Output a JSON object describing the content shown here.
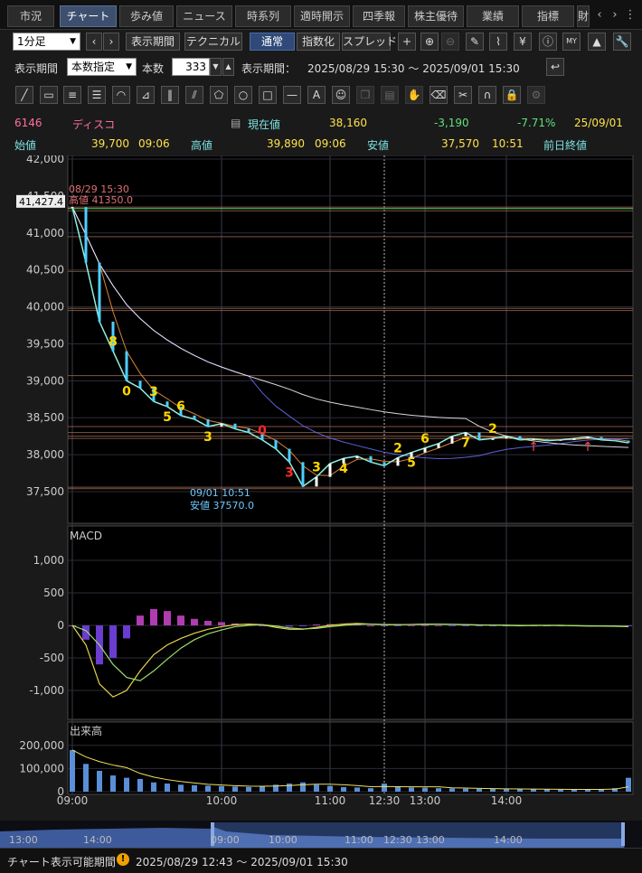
{
  "tabs": [
    "市況",
    "チャート",
    "歩み値",
    "ニュース",
    "時系列",
    "適時開示",
    "四季報",
    "株主優待",
    "業績",
    "指標",
    "財"
  ],
  "active_tab": 1,
  "toolbar": {
    "interval": "1分足",
    "display_period_btn": "表示期間",
    "technical_btn": "テクニカル",
    "normal_btn": "通常",
    "index_btn": "指数化",
    "spread_btn": "スプレッド",
    "my_label": "MY"
  },
  "period_row": {
    "label": "表示期間",
    "mode": "本数指定",
    "count_label": "本数",
    "count": "333",
    "range_label": "表示期間：",
    "range": "2025/08/29 15:30 〜 2025/09/01 15:30"
  },
  "quote": {
    "code": "6146",
    "name": "ディスコ",
    "current_label": "現在値",
    "current": "38,160",
    "change": "-3,190",
    "change_pct": "-7.71%",
    "date": "25/09/01",
    "open_label": "始値",
    "open": "39,700",
    "open_time": "09:06",
    "high_label": "高値",
    "high": "39,890",
    "high_time": "09:06",
    "low_label": "安値",
    "low": "37,570",
    "low_time": "10:51",
    "prev_close_label": "前日終値"
  },
  "colors": {
    "up": "#ff4a4a",
    "down": "#4ecfff",
    "accent": "#ffd700",
    "macd": "#e8d44d",
    "signal": "#9ade6a",
    "hist_pos": "#b03cb0",
    "hist_neg": "#6a3cd0"
  },
  "chart_data": [
    {
      "type": "line",
      "panel": "price",
      "ylim": [
        37500,
        42000
      ],
      "yticks": [
        "42,000",
        "41,500",
        "41,000",
        "40,500",
        "40,000",
        "39,500",
        "39,000",
        "38,500",
        "38,000",
        "37,500"
      ],
      "x": [
        "09:00",
        "09:02",
        "09:04",
        "09:06",
        "09:08",
        "09:10",
        "09:15",
        "09:20",
        "09:30",
        "09:40",
        "09:50",
        "10:00",
        "10:10",
        "10:20",
        "10:30",
        "10:40",
        "10:45",
        "10:51",
        "10:55",
        "11:00",
        "11:10",
        "11:20",
        "11:30",
        "12:30",
        "12:40",
        "12:50",
        "13:00",
        "13:10",
        "13:20",
        "13:30",
        "13:40",
        "13:50",
        "14:00",
        "14:10",
        "14:20",
        "14:30",
        "14:40",
        "14:50",
        "15:00",
        "15:10",
        "15:20",
        "15:30"
      ],
      "series": [
        {
          "values": [
            41350,
            40600,
            39800,
            39400,
            39000,
            38900,
            38720,
            38650,
            38530,
            38480,
            38380,
            38420,
            38350,
            38300,
            38200,
            38080,
            37900,
            37570,
            37700,
            37880,
            37950,
            37980,
            37900,
            37850,
            37960,
            38030,
            38090,
            38150,
            38250,
            38300,
            38200,
            38220,
            38250,
            38200,
            38210,
            38190,
            38200,
            38220,
            38240,
            38200,
            38190,
            38160
          ]
        }
      ],
      "prev_close_marker": "41,427.4",
      "annotations": [
        "08/29 15:30",
        "高値 41350.0",
        "09/01 10:51",
        "安値 37570.0"
      ],
      "count_labels": [
        "8",
        "0",
        "3",
        "5",
        "6",
        "3",
        "0",
        "3",
        "3",
        "4",
        "2",
        "5",
        "6",
        "7",
        "2"
      ],
      "xticks": [
        "09:00",
        "10:00",
        "11:00",
        "12:30",
        "13:00",
        "14:00"
      ]
    },
    {
      "type": "line",
      "panel": "macd",
      "title": "MACD",
      "ylim": [
        -1250,
        1250
      ],
      "yticks": [
        "1,000",
        "500",
        "0",
        "-500",
        "-1,000"
      ],
      "series": [
        {
          "values": [
            0,
            -300,
            -900,
            -1100,
            -1000,
            -700,
            -450,
            -300,
            -200,
            -120,
            -60,
            -20,
            10,
            20,
            10,
            -30,
            -60,
            -60,
            -30,
            0,
            20,
            30,
            20,
            10,
            10,
            15,
            20,
            20,
            15,
            10,
            5,
            5,
            0,
            -5,
            0,
            0,
            0,
            -5,
            -10,
            -10,
            -15,
            -20
          ]
        },
        {
          "values": [
            0,
            -80,
            -300,
            -600,
            -800,
            -850,
            -700,
            -520,
            -350,
            -220,
            -130,
            -70,
            -20,
            0,
            10,
            -10,
            -40,
            -55,
            -45,
            -20,
            0,
            15,
            20,
            15,
            12,
            13,
            16,
            18,
            16,
            12,
            8,
            6,
            3,
            0,
            0,
            0,
            0,
            -3,
            -6,
            -8,
            -10,
            -15
          ]
        }
      ]
    },
    {
      "type": "bar",
      "panel": "volume",
      "title": "出来高",
      "ylim": [
        0,
        250000
      ],
      "yticks": [
        "200,000",
        "100,000",
        "0"
      ],
      "values": [
        180000,
        120000,
        90000,
        70000,
        60000,
        55000,
        40000,
        35000,
        30000,
        28000,
        26000,
        24000,
        22000,
        20000,
        25000,
        30000,
        35000,
        40000,
        30000,
        25000,
        20000,
        18000,
        15000,
        35000,
        20000,
        18000,
        17000,
        15000,
        14000,
        13000,
        12000,
        12000,
        11000,
        11000,
        10000,
        10000,
        9000,
        9000,
        10000,
        12000,
        15000,
        60000
      ]
    }
  ],
  "navigator": {
    "labels": [
      "13:00",
      "14:00",
      "09:00",
      "10:00",
      "11:00",
      "12:30",
      "13:00",
      "14:00"
    ]
  },
  "footer": {
    "label": "チャート表示可能期間",
    "range": "2025/08/29 12:43 〜 2025/09/01 15:30"
  }
}
